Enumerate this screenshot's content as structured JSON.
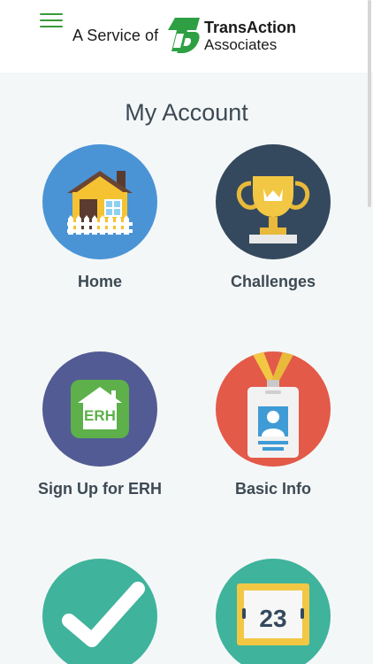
{
  "header": {
    "service_text": "A Service of",
    "brand_name": "TransAction",
    "brand_sub": "Associates"
  },
  "page": {
    "title": "My Account"
  },
  "tiles": [
    {
      "label": "Home",
      "icon": "house-icon",
      "color": "#4a94d6"
    },
    {
      "label": "Challenges",
      "icon": "trophy-icon",
      "color": "#34495e"
    },
    {
      "label": "Sign Up for ERH",
      "icon": "erh-house-icon",
      "color": "#535b94"
    },
    {
      "label": "Basic Info",
      "icon": "id-badge-icon",
      "color": "#e35a49"
    },
    {
      "label": "",
      "icon": "checkmark-icon",
      "color": "#3fb39b"
    },
    {
      "label": "",
      "icon": "calendar-icon",
      "color": "#3fb39b"
    }
  ],
  "erh_icon_text": "ERH",
  "calendar_day": "23",
  "colors": {
    "brand_green": "#2ea043",
    "menu_green": "#3a9a3a",
    "text_dark": "#3d4a54",
    "background": "#f4f7f8"
  }
}
